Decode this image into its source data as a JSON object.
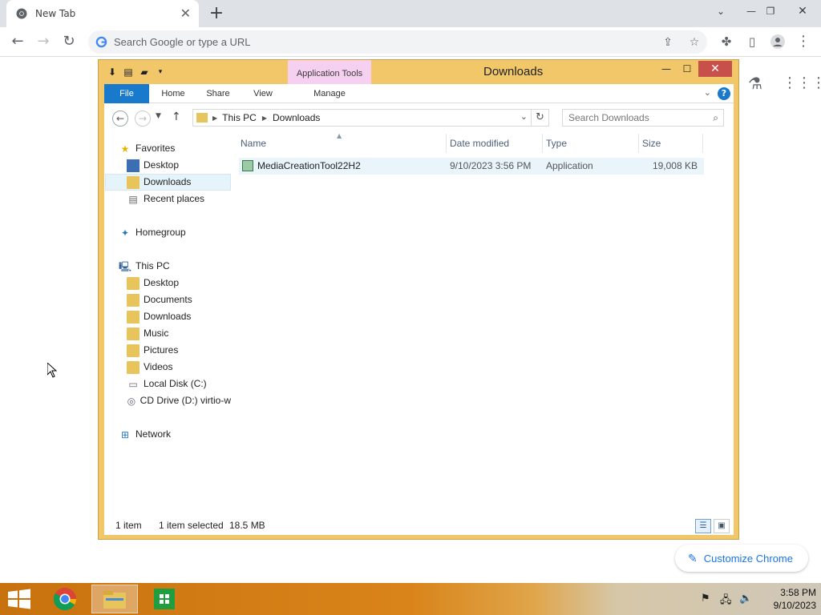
{
  "browser": {
    "tab_title": "New Tab",
    "omnibox_placeholder": "Search Google or type a URL",
    "customize_label": "Customize Chrome"
  },
  "explorer": {
    "title": "Downloads",
    "contextual_tab_group": "Application Tools",
    "ribbon_tabs": [
      "File",
      "Home",
      "Share",
      "View",
      "Manage"
    ],
    "breadcrumb": [
      "This PC",
      "Downloads"
    ],
    "search_placeholder": "Search Downloads",
    "nav": {
      "favorites_label": "Favorites",
      "favorites": [
        "Desktop",
        "Downloads",
        "Recent places"
      ],
      "homegroup_label": "Homegroup",
      "thispc_label": "This PC",
      "thispc": [
        "Desktop",
        "Documents",
        "Downloads",
        "Music",
        "Pictures",
        "Videos",
        "Local Disk (C:)",
        "CD Drive (D:) virtio-w"
      ],
      "network_label": "Network",
      "selected": "Downloads"
    },
    "columns": [
      "Name",
      "Date modified",
      "Type",
      "Size"
    ],
    "files": [
      {
        "name": "MediaCreationTool22H2",
        "date": "9/10/2023 3:56 PM",
        "type": "Application",
        "size": "19,008 KB"
      }
    ],
    "status": {
      "count": "1 item",
      "selected": "1 item selected",
      "size": "18.5 MB"
    }
  },
  "taskbar": {
    "time": "3:58 PM",
    "date": "9/10/2023"
  },
  "colors": {
    "explorer_frame": "#f2c76a",
    "file_tab": "#1979ca",
    "app_tools": "#f6d0f0",
    "close_button": "#c7504b",
    "chrome_link": "#1a73e8"
  }
}
